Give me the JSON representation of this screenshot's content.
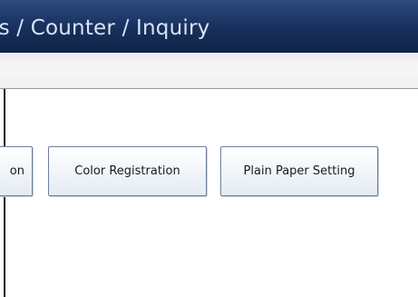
{
  "header": {
    "title": "ls / Counter / Inquiry"
  },
  "buttons": {
    "partial_label": "on",
    "color_registration": "Color Registration",
    "plain_paper_setting": "Plain Paper Setting"
  }
}
